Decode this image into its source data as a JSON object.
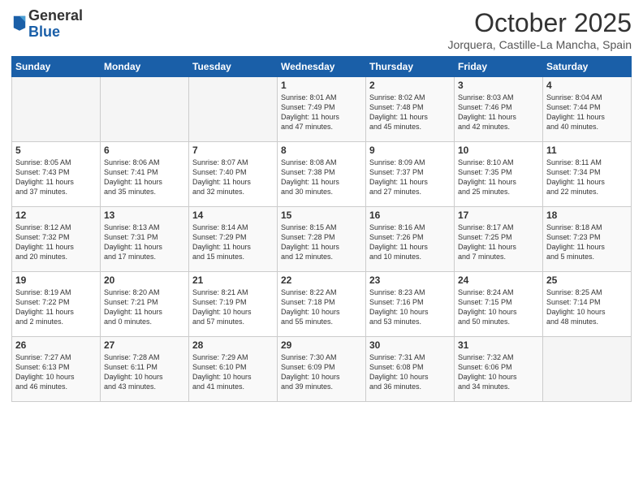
{
  "header": {
    "logo_line1": "General",
    "logo_line2": "Blue",
    "month": "October 2025",
    "location": "Jorquera, Castille-La Mancha, Spain"
  },
  "days_of_week": [
    "Sunday",
    "Monday",
    "Tuesday",
    "Wednesday",
    "Thursday",
    "Friday",
    "Saturday"
  ],
  "weeks": [
    [
      {
        "day": "",
        "info": ""
      },
      {
        "day": "",
        "info": ""
      },
      {
        "day": "",
        "info": ""
      },
      {
        "day": "1",
        "info": "Sunrise: 8:01 AM\nSunset: 7:49 PM\nDaylight: 11 hours\nand 47 minutes."
      },
      {
        "day": "2",
        "info": "Sunrise: 8:02 AM\nSunset: 7:48 PM\nDaylight: 11 hours\nand 45 minutes."
      },
      {
        "day": "3",
        "info": "Sunrise: 8:03 AM\nSunset: 7:46 PM\nDaylight: 11 hours\nand 42 minutes."
      },
      {
        "day": "4",
        "info": "Sunrise: 8:04 AM\nSunset: 7:44 PM\nDaylight: 11 hours\nand 40 minutes."
      }
    ],
    [
      {
        "day": "5",
        "info": "Sunrise: 8:05 AM\nSunset: 7:43 PM\nDaylight: 11 hours\nand 37 minutes."
      },
      {
        "day": "6",
        "info": "Sunrise: 8:06 AM\nSunset: 7:41 PM\nDaylight: 11 hours\nand 35 minutes."
      },
      {
        "day": "7",
        "info": "Sunrise: 8:07 AM\nSunset: 7:40 PM\nDaylight: 11 hours\nand 32 minutes."
      },
      {
        "day": "8",
        "info": "Sunrise: 8:08 AM\nSunset: 7:38 PM\nDaylight: 11 hours\nand 30 minutes."
      },
      {
        "day": "9",
        "info": "Sunrise: 8:09 AM\nSunset: 7:37 PM\nDaylight: 11 hours\nand 27 minutes."
      },
      {
        "day": "10",
        "info": "Sunrise: 8:10 AM\nSunset: 7:35 PM\nDaylight: 11 hours\nand 25 minutes."
      },
      {
        "day": "11",
        "info": "Sunrise: 8:11 AM\nSunset: 7:34 PM\nDaylight: 11 hours\nand 22 minutes."
      }
    ],
    [
      {
        "day": "12",
        "info": "Sunrise: 8:12 AM\nSunset: 7:32 PM\nDaylight: 11 hours\nand 20 minutes."
      },
      {
        "day": "13",
        "info": "Sunrise: 8:13 AM\nSunset: 7:31 PM\nDaylight: 11 hours\nand 17 minutes."
      },
      {
        "day": "14",
        "info": "Sunrise: 8:14 AM\nSunset: 7:29 PM\nDaylight: 11 hours\nand 15 minutes."
      },
      {
        "day": "15",
        "info": "Sunrise: 8:15 AM\nSunset: 7:28 PM\nDaylight: 11 hours\nand 12 minutes."
      },
      {
        "day": "16",
        "info": "Sunrise: 8:16 AM\nSunset: 7:26 PM\nDaylight: 11 hours\nand 10 minutes."
      },
      {
        "day": "17",
        "info": "Sunrise: 8:17 AM\nSunset: 7:25 PM\nDaylight: 11 hours\nand 7 minutes."
      },
      {
        "day": "18",
        "info": "Sunrise: 8:18 AM\nSunset: 7:23 PM\nDaylight: 11 hours\nand 5 minutes."
      }
    ],
    [
      {
        "day": "19",
        "info": "Sunrise: 8:19 AM\nSunset: 7:22 PM\nDaylight: 11 hours\nand 2 minutes."
      },
      {
        "day": "20",
        "info": "Sunrise: 8:20 AM\nSunset: 7:21 PM\nDaylight: 11 hours\nand 0 minutes."
      },
      {
        "day": "21",
        "info": "Sunrise: 8:21 AM\nSunset: 7:19 PM\nDaylight: 10 hours\nand 57 minutes."
      },
      {
        "day": "22",
        "info": "Sunrise: 8:22 AM\nSunset: 7:18 PM\nDaylight: 10 hours\nand 55 minutes."
      },
      {
        "day": "23",
        "info": "Sunrise: 8:23 AM\nSunset: 7:16 PM\nDaylight: 10 hours\nand 53 minutes."
      },
      {
        "day": "24",
        "info": "Sunrise: 8:24 AM\nSunset: 7:15 PM\nDaylight: 10 hours\nand 50 minutes."
      },
      {
        "day": "25",
        "info": "Sunrise: 8:25 AM\nSunset: 7:14 PM\nDaylight: 10 hours\nand 48 minutes."
      }
    ],
    [
      {
        "day": "26",
        "info": "Sunrise: 7:27 AM\nSunset: 6:13 PM\nDaylight: 10 hours\nand 46 minutes."
      },
      {
        "day": "27",
        "info": "Sunrise: 7:28 AM\nSunset: 6:11 PM\nDaylight: 10 hours\nand 43 minutes."
      },
      {
        "day": "28",
        "info": "Sunrise: 7:29 AM\nSunset: 6:10 PM\nDaylight: 10 hours\nand 41 minutes."
      },
      {
        "day": "29",
        "info": "Sunrise: 7:30 AM\nSunset: 6:09 PM\nDaylight: 10 hours\nand 39 minutes."
      },
      {
        "day": "30",
        "info": "Sunrise: 7:31 AM\nSunset: 6:08 PM\nDaylight: 10 hours\nand 36 minutes."
      },
      {
        "day": "31",
        "info": "Sunrise: 7:32 AM\nSunset: 6:06 PM\nDaylight: 10 hours\nand 34 minutes."
      },
      {
        "day": "",
        "info": ""
      }
    ]
  ]
}
